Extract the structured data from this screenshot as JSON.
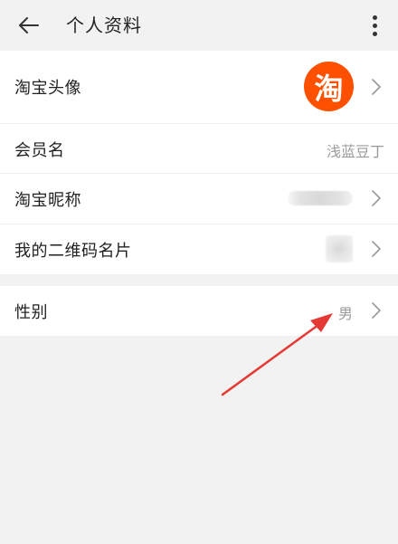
{
  "header": {
    "title": "个人资料"
  },
  "profile": {
    "avatar_label": "淘宝头像",
    "avatar_glyph": "淘",
    "member_name_label": "会员名",
    "member_name_value": "浅蓝豆丁",
    "nickname_label": "淘宝昵称",
    "qr_label": "我的二维码名片",
    "gender_label": "性别",
    "gender_value": "男"
  },
  "icons": {
    "back": "arrow-left-icon",
    "more": "more-vertical-icon",
    "chevron": "chevron-right-icon"
  },
  "colors": {
    "brand": "#ff5000",
    "annotation_arrow": "#e53935"
  }
}
